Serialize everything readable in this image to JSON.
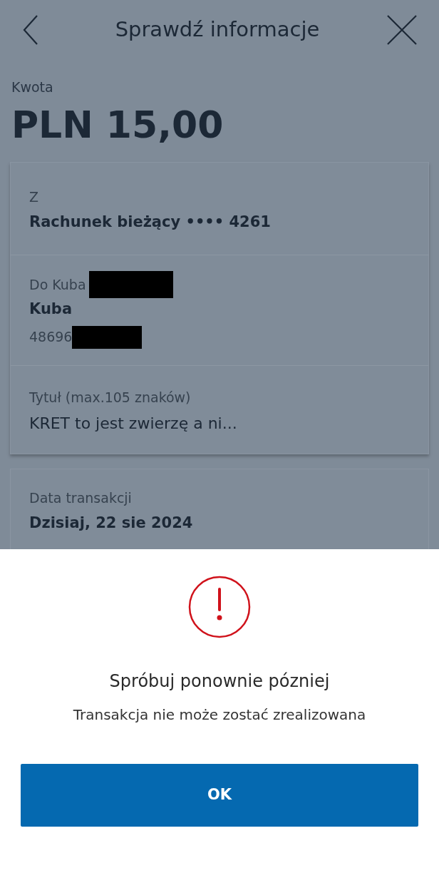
{
  "header": {
    "title": "Sprawdź informacje"
  },
  "amount": {
    "label": "Kwota",
    "value": "PLN 15,00"
  },
  "details_card": [
    {
      "label": "Z",
      "label_redacted": false,
      "value": "Rachunek bieżący •••• 4261",
      "value_bold": true
    },
    {
      "label": "Do Kuba",
      "label_redacted": true,
      "value": "Kuba",
      "value_bold": true,
      "extra": "48696",
      "extra_redacted": true
    },
    {
      "label": "Tytuł (max.105 znaków)",
      "label_redacted": false,
      "value": "KRET to jest zwierzę a ni...",
      "value_bold": false
    }
  ],
  "date_card": {
    "label": "Data transakcji",
    "value": "Dzisiaj, 22 sie 2024"
  },
  "dialog": {
    "title": "Spróbuj ponownie pózniej",
    "message": "Transakcja nie może zostać zrealizowana",
    "button": "OK"
  }
}
